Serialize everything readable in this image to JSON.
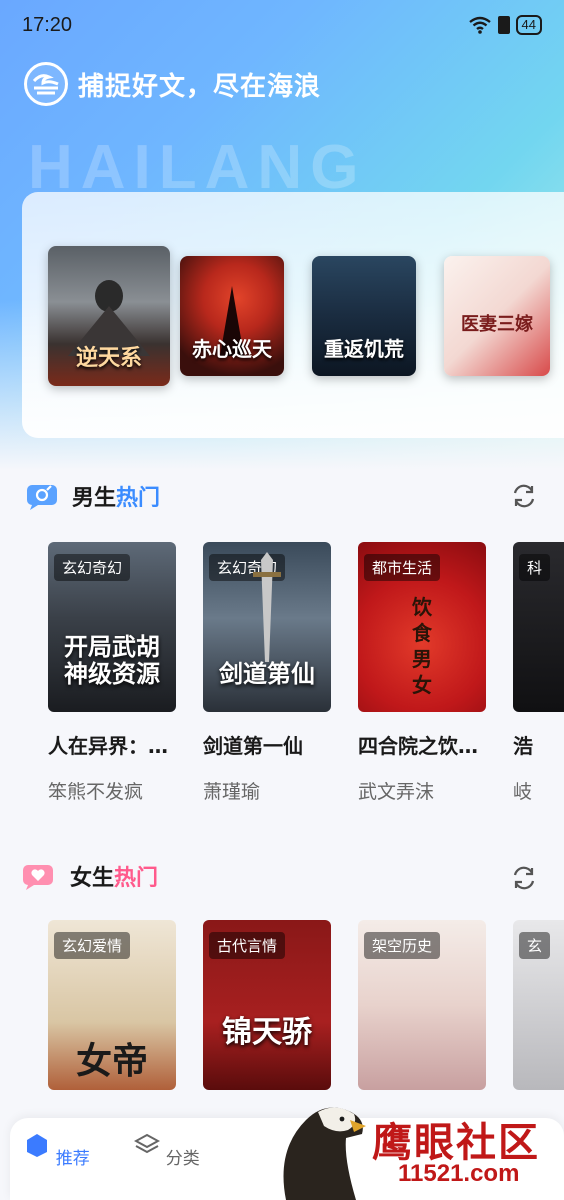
{
  "status_bar": {
    "time": "17:20",
    "battery": "44"
  },
  "header": {
    "slogan": "捕捉好文，尽在海浪",
    "watermark": "HAILANG"
  },
  "featured": [
    {
      "cover_text": "逆天系"
    },
    {
      "cover_text": "赤心巡天"
    },
    {
      "cover_text": "重返饥荒"
    },
    {
      "cover_text": "医妻三嫁"
    }
  ],
  "male_section": {
    "title_prefix": "男生",
    "title_highlight": "热门",
    "books": [
      {
        "genre": "玄幻奇幻",
        "cover_text": "开局武胡\n神级资源",
        "title": "人在异界：…",
        "author": "笨熊不发疯"
      },
      {
        "genre": "玄幻奇幻",
        "cover_text": "剑道第仙",
        "title": "剑道第一仙",
        "author": "萧瑾瑜"
      },
      {
        "genre": "都市生活",
        "cover_text": "饮\n食\n男\n女",
        "title": "四合院之饮…",
        "author": "武文弄沫"
      },
      {
        "genre": "科",
        "cover_text": "",
        "title": "浩",
        "author": "岐"
      }
    ]
  },
  "female_section": {
    "title_prefix": "女生",
    "title_highlight": "热门",
    "books": [
      {
        "genre": "玄幻爱情",
        "cover_text": "女帝"
      },
      {
        "genre": "古代言情",
        "cover_text": "锦天骄"
      },
      {
        "genre": "架空历史",
        "cover_text": ""
      },
      {
        "genre": "玄",
        "cover_text": ""
      }
    ]
  },
  "bottom_nav": [
    {
      "label": "推荐",
      "active": true
    },
    {
      "label": "分类",
      "active": false
    }
  ],
  "site_watermark": {
    "line1": "鹰眼社区",
    "line2": "11521.com"
  },
  "colors": {
    "accent": "#3b8cff",
    "female_accent": "#ff5a8c"
  }
}
